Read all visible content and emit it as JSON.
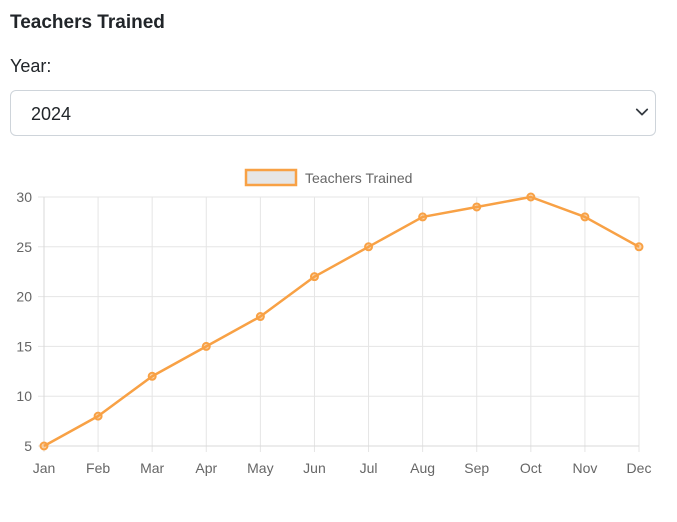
{
  "title": "Teachers Trained",
  "year_filter": {
    "label": "Year:",
    "selected": "2024"
  },
  "colors": {
    "line": "#f8a145",
    "legend_fill": "#e6e6e6",
    "grid": "#e5e5e5",
    "text": "#666666"
  },
  "chart_data": {
    "type": "line",
    "title": "",
    "xlabel": "",
    "ylabel": "",
    "categories": [
      "Jan",
      "Feb",
      "Mar",
      "Apr",
      "May",
      "Jun",
      "Jul",
      "Aug",
      "Sep",
      "Oct",
      "Nov",
      "Dec"
    ],
    "series": [
      {
        "name": "Teachers Trained",
        "values": [
          5,
          8,
          12,
          15,
          18,
          22,
          25,
          28,
          29,
          30,
          28,
          25
        ]
      }
    ],
    "ylim": [
      5,
      30
    ],
    "yticks": [
      5,
      10,
      15,
      20,
      25,
      30
    ],
    "grid": true,
    "legend_position": "top-center"
  }
}
